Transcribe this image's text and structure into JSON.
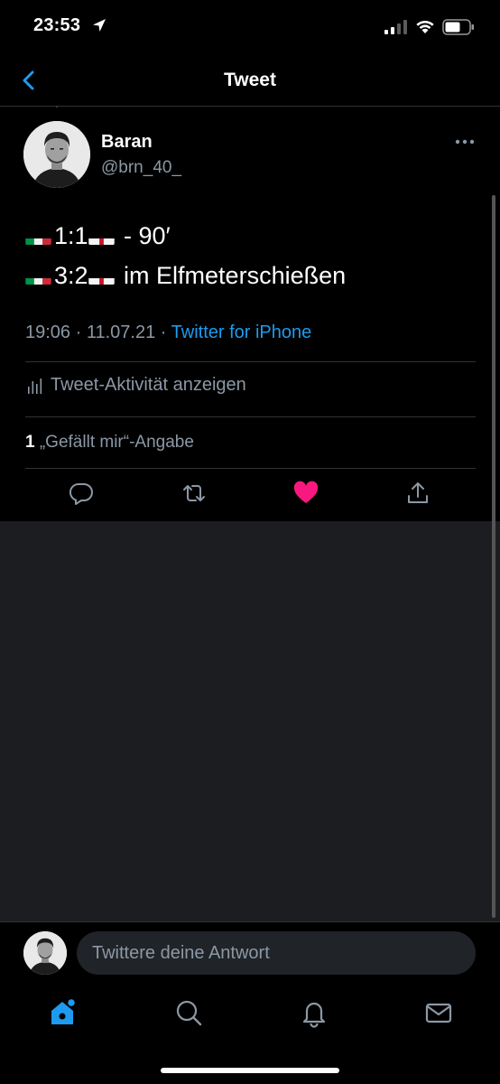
{
  "status_bar": {
    "time": "23:53"
  },
  "nav": {
    "title": "Tweet"
  },
  "tweet": {
    "author_name": "Baran",
    "author_handle": "@brn_40_",
    "lines": [
      {
        "score": "1:1",
        "suffix": " - 90′"
      },
      {
        "score": "3:2",
        "suffix": " im Elfmeterschießen"
      }
    ],
    "time": "19:06",
    "date": "11.07.21",
    "source": "Twitter for iPhone",
    "activity_label": "Tweet-Aktivität anzeigen",
    "like_count": "1",
    "like_label": "„Gefällt mir“-Angabe"
  },
  "icons": {
    "status": [
      "location-arrow-icon",
      "signal-icon",
      "wifi-icon",
      "battery-icon"
    ],
    "actions": [
      "reply-icon",
      "retweet-icon",
      "like-icon",
      "share-icon"
    ],
    "tabs": [
      "home-icon",
      "search-icon",
      "notifications-icon",
      "messages-icon"
    ]
  },
  "colors": {
    "accent": "#1d9bf0",
    "like": "#f91880",
    "muted": "#8b98a5"
  },
  "reply": {
    "placeholder": "Twittere deine Antwort"
  }
}
